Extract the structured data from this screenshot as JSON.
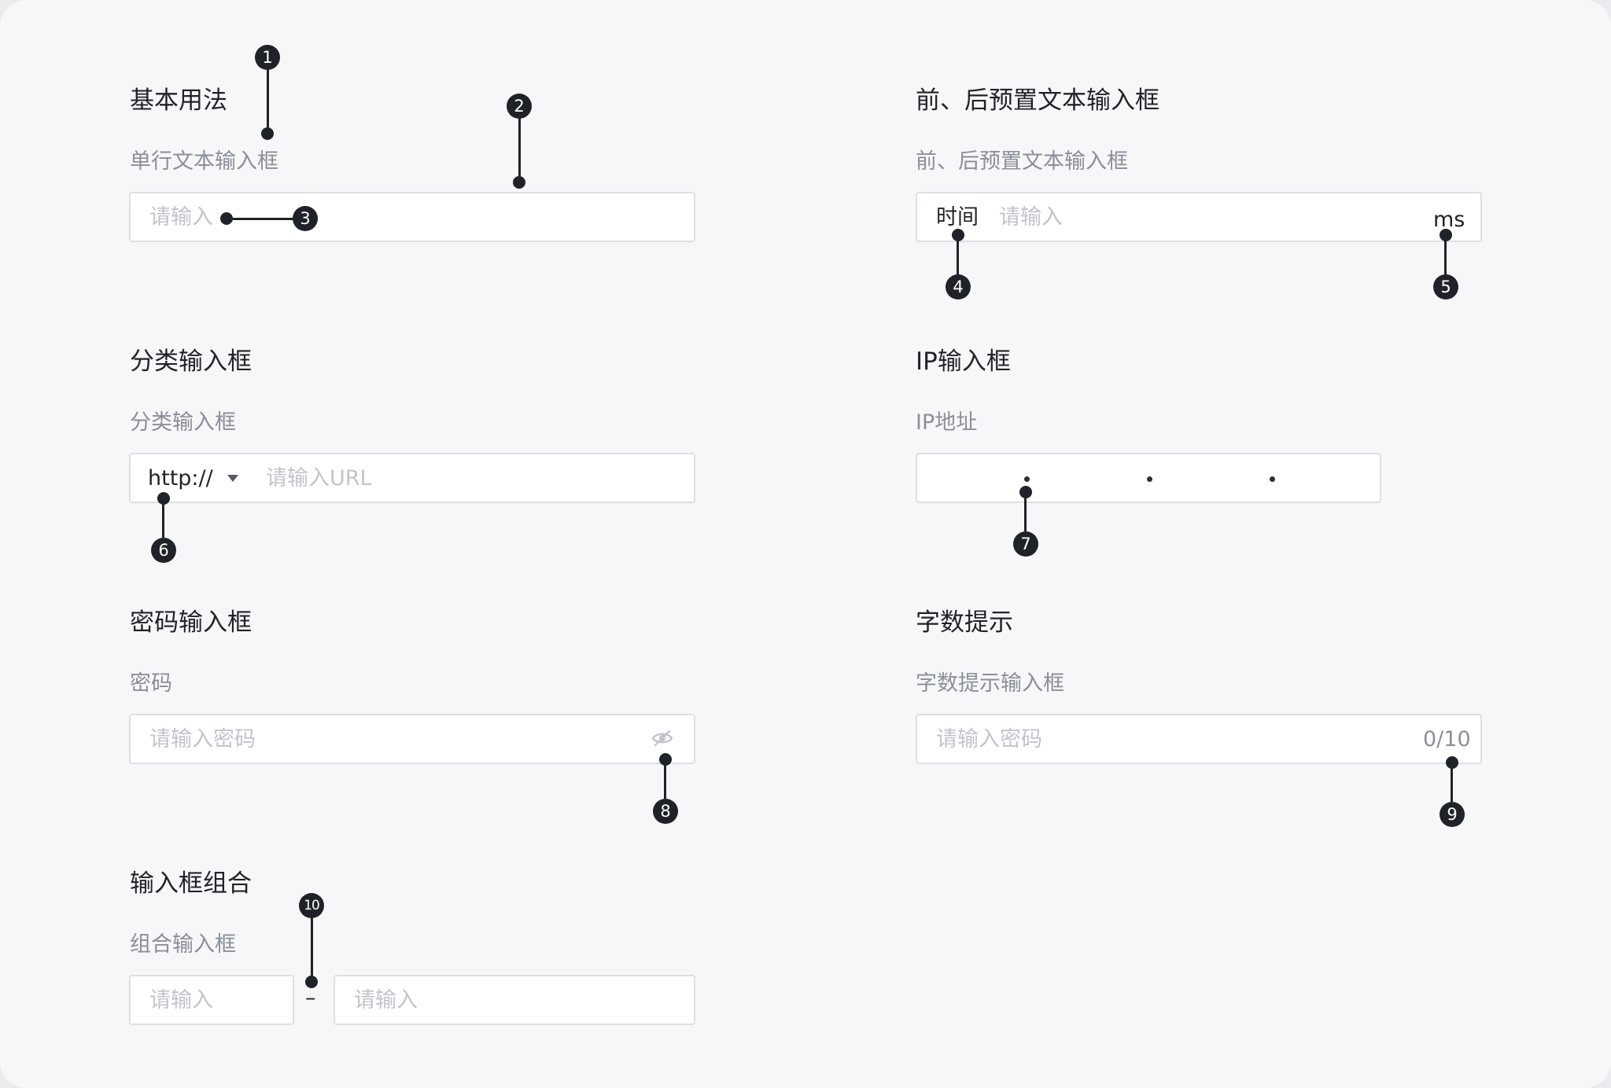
{
  "sections": {
    "basic": {
      "title": "基本用法",
      "label": "单行文本输入框",
      "placeholder": "请输入"
    },
    "affix": {
      "title": "前、后预置文本输入框",
      "label": "前、后预置文本输入框",
      "prefix": "时间",
      "placeholder": "请输入",
      "suffix": "ms"
    },
    "category": {
      "title": "分类输入框",
      "label": "分类输入框",
      "select_value": "http://",
      "placeholder": "请输入URL"
    },
    "ip": {
      "title": "IP输入框",
      "label": "IP地址"
    },
    "password": {
      "title": "密码输入框",
      "label": "密码",
      "placeholder": "请输入密码",
      "toggle_icon": "eye-off-icon"
    },
    "count": {
      "title": "字数提示",
      "label": "字数提示输入框",
      "placeholder": "请输入密码",
      "counter": "0/10"
    },
    "group": {
      "title": "输入框组合",
      "label": "组合输入框",
      "placeholder_start": "请输入",
      "separator": "–",
      "placeholder_end": "请输入"
    }
  },
  "callouts": [
    "1",
    "2",
    "3",
    "4",
    "5",
    "6",
    "7",
    "8",
    "9",
    "10"
  ],
  "colors": {
    "background": "#f7f7f9",
    "border": "#dcdfe6",
    "callout": "#1f2329",
    "placeholder": "#c0c4cc"
  }
}
